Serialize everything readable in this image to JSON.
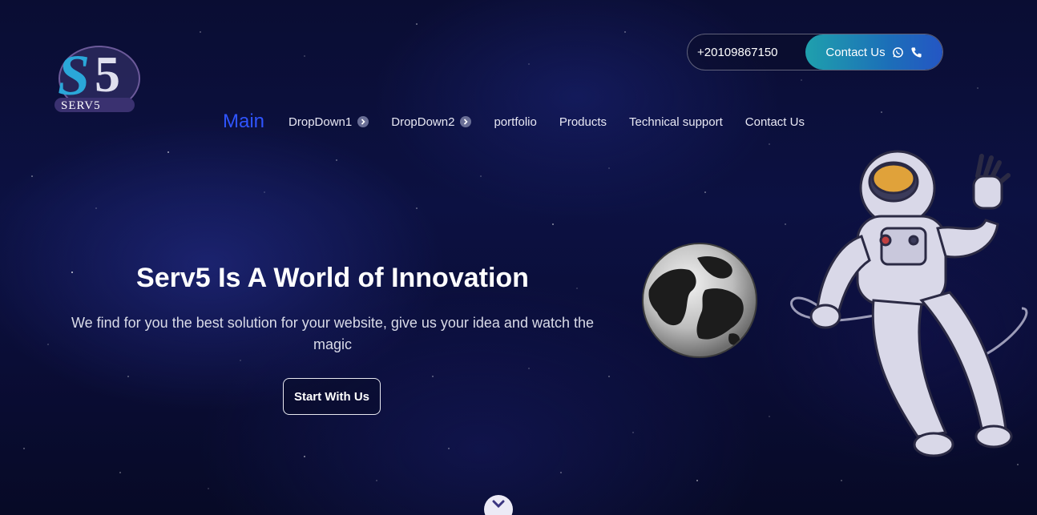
{
  "header": {
    "logo_text": "SERV5",
    "phone": "+20109867150",
    "contact_label": "Contact Us"
  },
  "nav": {
    "items": [
      {
        "label": "Main",
        "active": true
      },
      {
        "label": "DropDown1",
        "has_dropdown": true
      },
      {
        "label": "DropDown2",
        "has_dropdown": true
      },
      {
        "label": "portfolio"
      },
      {
        "label": "Products"
      },
      {
        "label": "Technical support"
      },
      {
        "label": "Contact Us"
      }
    ]
  },
  "hero": {
    "title": "Serv5 Is A World of Innovation",
    "subtitle": "We find for you the best solution for your website, give us your idea and watch the magic",
    "cta_label": "Start With Us"
  },
  "icons": {
    "whatsapp": "whatsapp-icon",
    "phone": "phone-icon",
    "chevron": "chevron-right-icon",
    "scroll": "chevron-down-icon"
  },
  "colors": {
    "background": "#0c1142",
    "nav_active": "#2f54ff",
    "contact_gradient_start": "#1fa0ad",
    "contact_gradient_end": "#2456c4"
  }
}
